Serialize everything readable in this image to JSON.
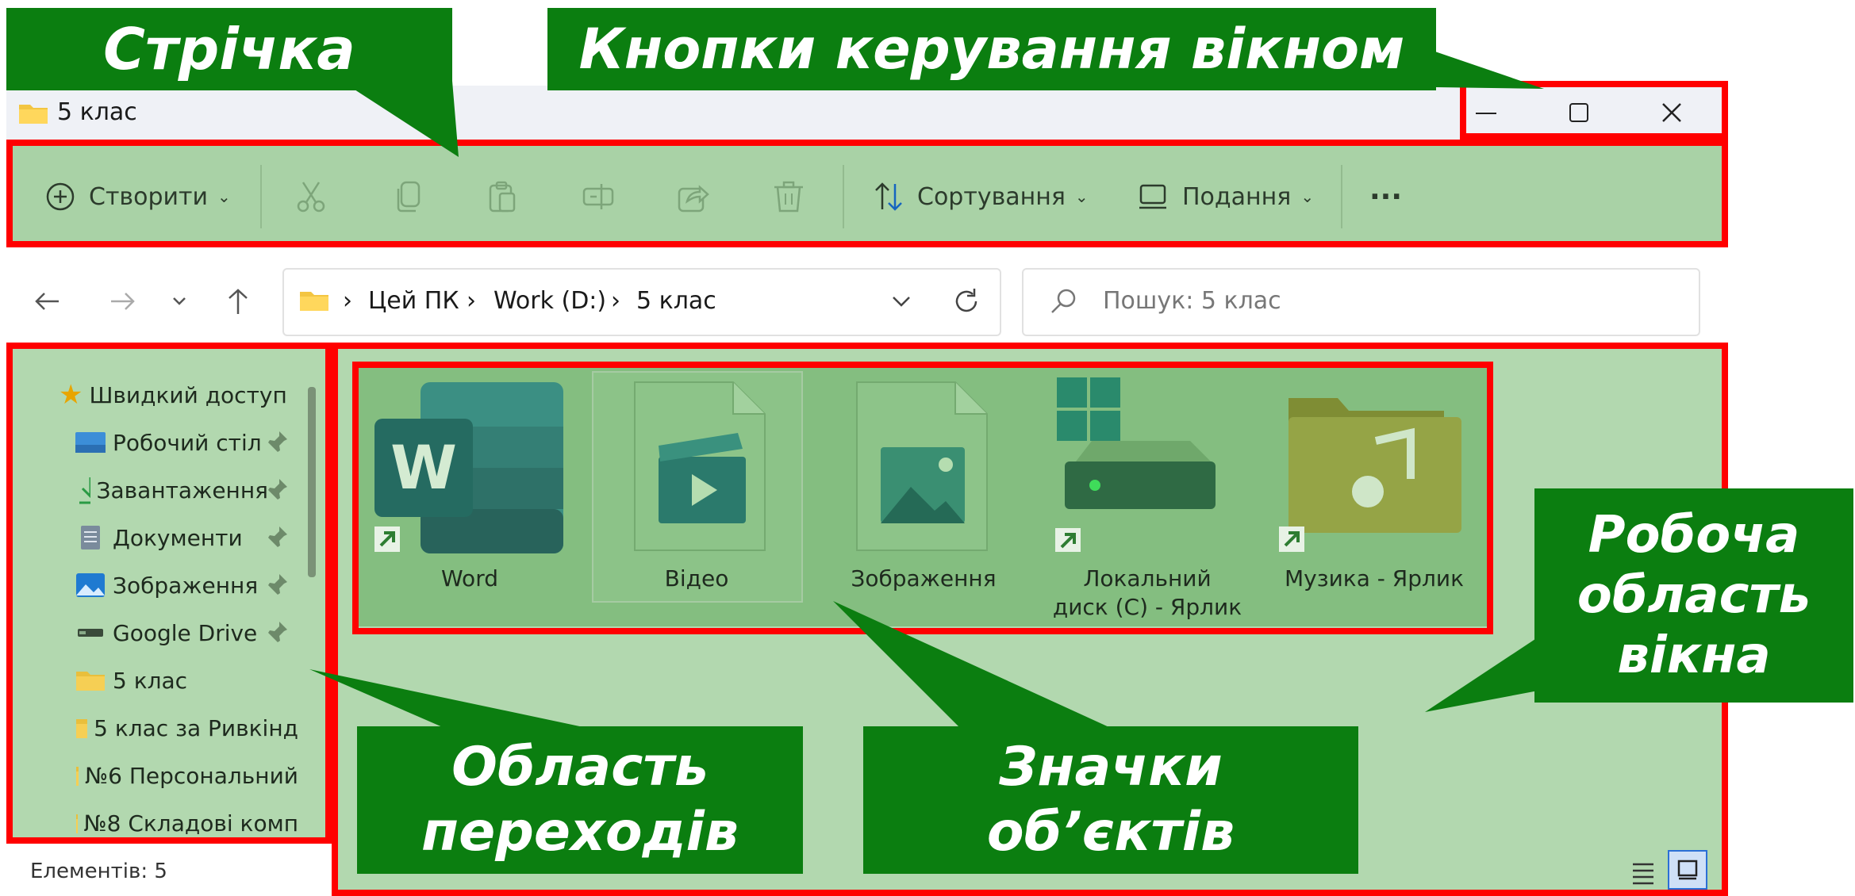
{
  "window": {
    "title": "5 клас",
    "controls": {
      "minimize": "—",
      "maximize": "☐",
      "close": "✕"
    }
  },
  "ribbon": {
    "create_label": "Створити",
    "sort_label": "Сортування",
    "view_label": "Подання",
    "more_label": "···"
  },
  "address": {
    "breadcrumbs": [
      "Цей ПК",
      "Work (D:)",
      "5 клас"
    ],
    "search_placeholder": "Пошук: 5 клас"
  },
  "nav": {
    "items": [
      {
        "label": "Швидкий доступ"
      },
      {
        "label": "Робочий стіл"
      },
      {
        "label": "Завантаження"
      },
      {
        "label": "Документи"
      },
      {
        "label": "Зображення"
      },
      {
        "label": "Google Drive"
      },
      {
        "label": "5 клас"
      },
      {
        "label": "5 клас за Ривкінд"
      },
      {
        "label": "№6 Персональний"
      },
      {
        "label": "№8 Складові комп"
      }
    ]
  },
  "files": [
    {
      "label": "Word"
    },
    {
      "label": "Відео"
    },
    {
      "label": "Зображення"
    },
    {
      "label": "Локальний диск (C) - Ярлик"
    },
    {
      "label": "Музика - Ярлик"
    }
  ],
  "status": {
    "count": "Елементів: 5"
  },
  "callouts": {
    "ribbon": "Стрічка",
    "window_controls": "Кнопки керування вікном",
    "work_area": "Робоча область вікна",
    "nav_area": "Область переходів",
    "object_icons": "Значки об’єктів"
  },
  "colors": {
    "callout_green": "#0b7e10",
    "highlight_red": "#ff0000",
    "overlay_green": "#b2d8af"
  }
}
